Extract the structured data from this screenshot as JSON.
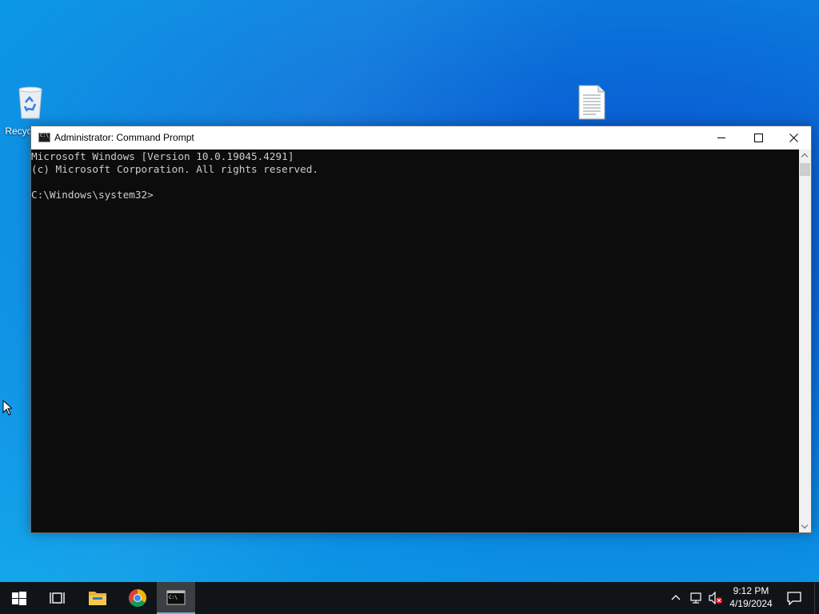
{
  "desktop": {
    "icons": [
      {
        "label": "Recycle Bin",
        "icon": "recycle-bin-icon"
      },
      {
        "label": "",
        "icon": "text-document-icon"
      }
    ]
  },
  "window": {
    "title": "Administrator: Command Prompt",
    "icon": "command-prompt-icon",
    "controls": [
      "minimize",
      "maximize",
      "close"
    ]
  },
  "console": {
    "lines": [
      "Microsoft Windows [Version 10.0.19045.4291]",
      "(c) Microsoft Corporation. All rights reserved.",
      "",
      "C:\\Windows\\system32>"
    ],
    "text_color": "#cccccc",
    "background": "#0c0c0c"
  },
  "taskbar": {
    "apps": [
      "start-button",
      "task-view",
      "file-explorer",
      "google-chrome",
      "command-prompt"
    ],
    "active_app": "command-prompt",
    "tray": {
      "time": "9:12 PM",
      "date": "4/19/2024"
    }
  },
  "colors": {
    "taskbar": "#101418",
    "desktop_accent": "#0a78dc",
    "titlebar": "#ffffff"
  }
}
